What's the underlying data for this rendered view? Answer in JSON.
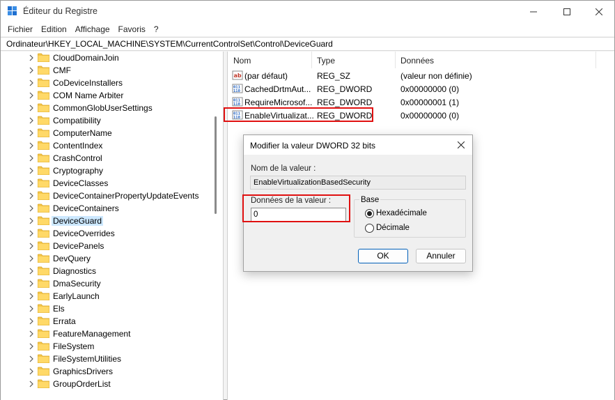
{
  "window": {
    "title": "Éditeur du Registre",
    "minimize_icon": "minimize-icon",
    "maximize_icon": "maximize-icon",
    "close_icon": "close-icon"
  },
  "menu": [
    "Fichier",
    "Edition",
    "Affichage",
    "Favoris",
    "?"
  ],
  "address": "Ordinateur\\HKEY_LOCAL_MACHINE\\SYSTEM\\CurrentControlSet\\Control\\DeviceGuard",
  "tree": {
    "items": [
      "CloudDomainJoin",
      "CMF",
      "CoDeviceInstallers",
      "COM Name Arbiter",
      "CommonGlobUserSettings",
      "Compatibility",
      "ComputerName",
      "ContentIndex",
      "CrashControl",
      "Cryptography",
      "DeviceClasses",
      "DeviceContainerPropertyUpdateEvents",
      "DeviceContainers",
      "DeviceGuard",
      "DeviceOverrides",
      "DevicePanels",
      "DevQuery",
      "Diagnostics",
      "DmaSecurity",
      "EarlyLaunch",
      "Els",
      "Errata",
      "FeatureManagement",
      "FileSystem",
      "FileSystemUtilities",
      "GraphicsDrivers",
      "GroupOrderList"
    ],
    "selected": "DeviceGuard"
  },
  "list": {
    "columns": [
      "Nom",
      "Type",
      "Données"
    ],
    "rows": [
      {
        "name": "(par défaut)",
        "type": "REG_SZ",
        "data": "(valeur non définie)",
        "icon": "string-value-icon"
      },
      {
        "name": "CachedDrtmAut...",
        "type": "REG_DWORD",
        "data": "0x00000000 (0)",
        "icon": "binary-value-icon"
      },
      {
        "name": "RequireMicrosof...",
        "type": "REG_DWORD",
        "data": "0x00000001 (1)",
        "icon": "binary-value-icon"
      },
      {
        "name": "EnableVirtualizat...",
        "type": "REG_DWORD",
        "data": "0x00000000 (0)",
        "icon": "binary-value-icon"
      }
    ]
  },
  "dialog": {
    "title": "Modifier la valeur DWORD 32 bits",
    "name_label": "Nom de la valeur :",
    "name_value": "EnableVirtualizationBasedSecurity",
    "data_label": "Données de la valeur :",
    "data_value": "0",
    "base_label": "Base",
    "hex_label": "Hexadécimale",
    "dec_label": "Décimale",
    "base_selected": "hex",
    "ok_label": "OK",
    "cancel_label": "Annuler"
  }
}
